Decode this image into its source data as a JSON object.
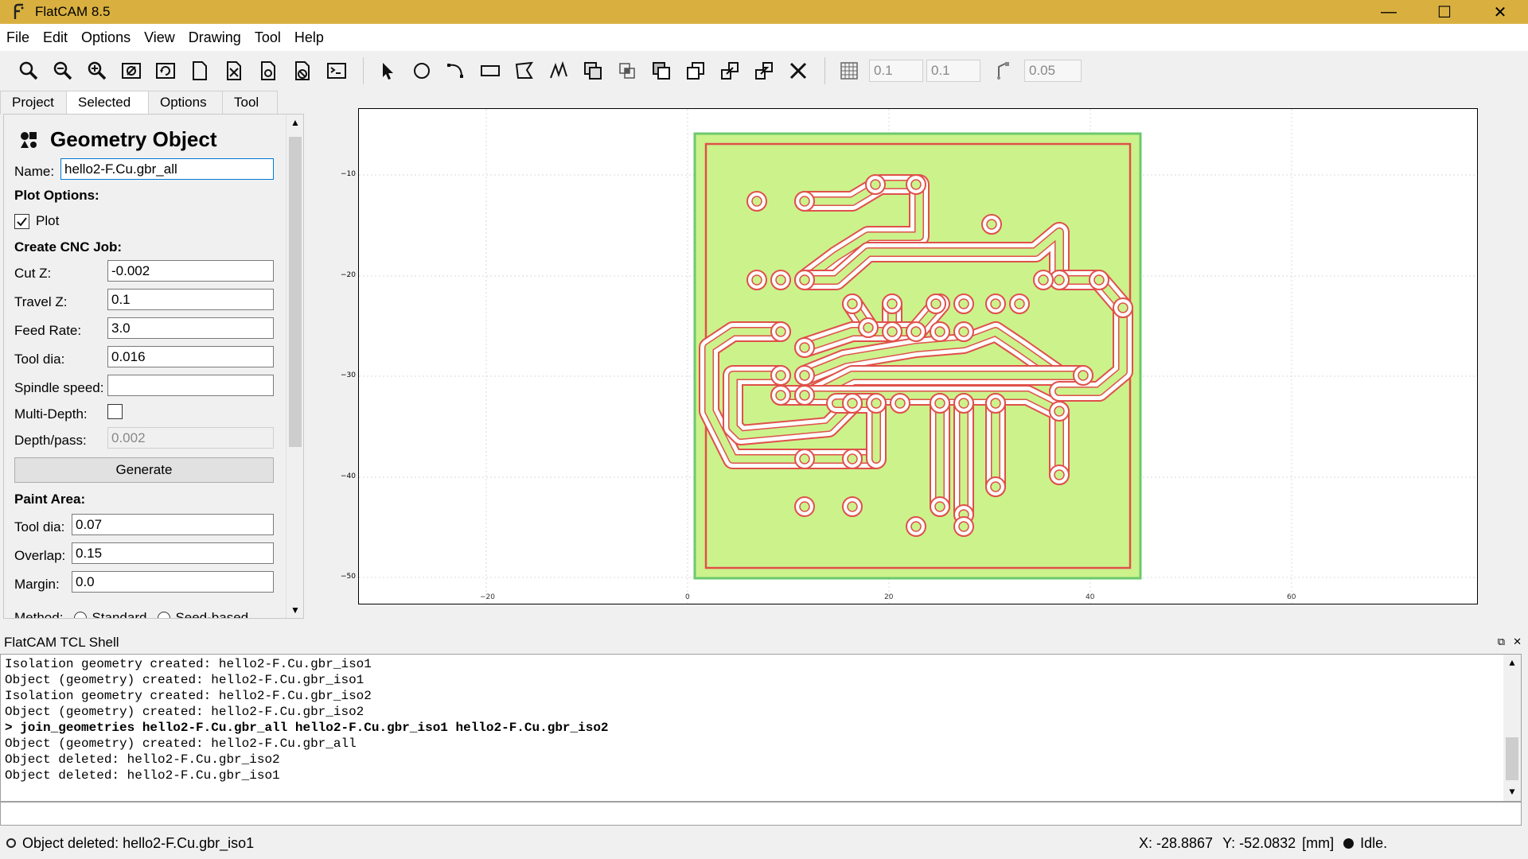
{
  "window": {
    "title": "FlatCAM 8.5",
    "minimize_glyph": "—",
    "maximize_glyph": "☐",
    "close_glyph": "✕"
  },
  "menu": [
    "File",
    "Edit",
    "Options",
    "View",
    "Drawing",
    "Tool",
    "Help"
  ],
  "toolbar": {
    "file_tools": [
      "zoom-fit-icon",
      "zoom-out-icon",
      "zoom-in-icon",
      "clear-plot-icon",
      "replot-icon",
      "new-geometry-icon",
      "open-gerber-icon",
      "open-excellon-icon",
      "delete-object-icon",
      "shell-icon"
    ],
    "draw_tools": [
      "select-icon",
      "circle-icon",
      "arc-icon",
      "rectangle-icon",
      "polygon-icon",
      "path-icon",
      "union-icon",
      "intersection-icon",
      "subtraction-icon",
      "cut-icon",
      "move-icon",
      "copy-icon",
      "delete-shape-icon"
    ],
    "grid_x": "0.1",
    "grid_y": "0.1",
    "snap_max": "0.05"
  },
  "tabs": [
    "Project",
    "Selected",
    "Options",
    "Tool"
  ],
  "active_tab": "Selected",
  "panel": {
    "title": "Geometry Object",
    "name_label": "Name:",
    "name_value": "hello2-F.Cu.gbr_all",
    "plot_options": "Plot Options:",
    "plot_label": "Plot",
    "plot_checked": true,
    "create_cnc": "Create CNC Job:",
    "cut_z_label": "Cut Z:",
    "cut_z": "-0.002",
    "travel_z_label": "Travel Z:",
    "travel_z": "0.1",
    "feed_rate_label": "Feed Rate:",
    "feed_rate": "3.0",
    "tool_dia_label": "Tool dia:",
    "tool_dia": "0.016",
    "spindle_label": "Spindle speed:",
    "spindle": "",
    "multi_depth_label": "Multi-Depth:",
    "multi_depth_checked": false,
    "depth_pass_label": "Depth/pass:",
    "depth_pass": "0.002",
    "generate": "Generate",
    "paint_area": "Paint Area:",
    "paint_tool_dia_label": "Tool dia:",
    "paint_tool_dia": "0.07",
    "overlap_label": "Overlap:",
    "overlap": "0.15",
    "margin_label": "Margin:",
    "margin": "0.0",
    "method_label": "Method:",
    "method_options": [
      "Standard",
      "Seed-based"
    ]
  },
  "plot": {
    "x_ticks": [
      "−20",
      "0",
      "20",
      "40",
      "60"
    ],
    "y_ticks": [
      "−10",
      "−20",
      "−30",
      "−40",
      "−50"
    ],
    "board_fill": "#ccf28c",
    "outline_green": "#6cc96c",
    "trace_red": "#e0504a"
  },
  "shell": {
    "title": "FlatCAM TCL Shell",
    "undock_glyph": "⧉",
    "close_glyph": "✕",
    "lines": [
      {
        "text": "Isolation geometry created: hello2-F.Cu.gbr_iso1",
        "bold": false
      },
      {
        "text": "Object (geometry) created: hello2-F.Cu.gbr_iso1",
        "bold": false
      },
      {
        "text": "Isolation geometry created: hello2-F.Cu.gbr_iso2",
        "bold": false
      },
      {
        "text": "Object (geometry) created: hello2-F.Cu.gbr_iso2",
        "bold": false
      },
      {
        "text": "> join_geometries hello2-F.Cu.gbr_all hello2-F.Cu.gbr_iso1 hello2-F.Cu.gbr_iso2",
        "bold": true
      },
      {
        "text": "Object (geometry) created: hello2-F.Cu.gbr_all",
        "bold": false
      },
      {
        "text": "Object deleted: hello2-F.Cu.gbr_iso2",
        "bold": false
      },
      {
        "text": "Object deleted: hello2-F.Cu.gbr_iso1",
        "bold": false
      }
    ]
  },
  "status": {
    "message": "Object deleted: hello2-F.Cu.gbr_iso1",
    "x": "X: -28.8867",
    "y": "Y: -52.0832",
    "units": "[mm]",
    "state": "Idle."
  }
}
